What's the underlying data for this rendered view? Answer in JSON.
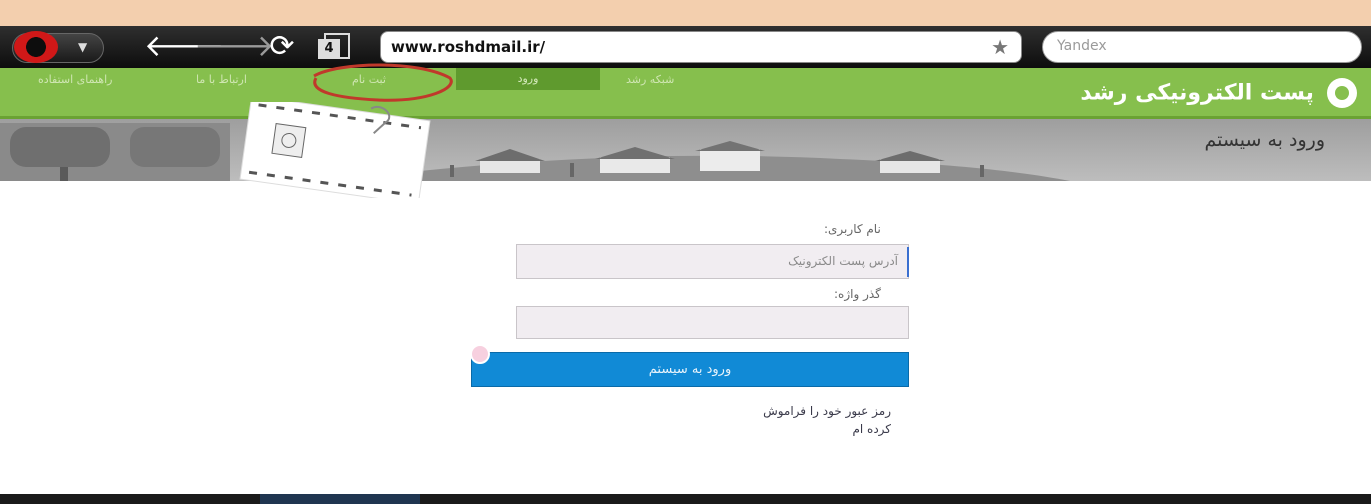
{
  "browser": {
    "url": "www.roshdmail.ir/",
    "search_placeholder": "Yandex",
    "tab_count": "4"
  },
  "site": {
    "brand": "پست الکترونیکی رشد",
    "menu": [
      {
        "label": "راهنمای استفاده"
      },
      {
        "label": "ارتباط با ما"
      },
      {
        "label": "ثبت نام"
      },
      {
        "label": "ورود"
      },
      {
        "label": "شبکه رشد"
      }
    ],
    "page_title": "ورود به سیستم"
  },
  "form": {
    "username_label": "نام کاربری:",
    "username_placeholder": "آدرس پست الکترونیک",
    "password_label": "گذر واژه:",
    "submit_label": "ورود به سیستم",
    "forgot_label": "رمز عبور خود را فراموش کرده ام"
  },
  "colors": {
    "header_green": "#86bf4d",
    "active_menu": "#5f9a2e",
    "button_blue": "#118ad6",
    "annotation_red": "#c0392b"
  }
}
